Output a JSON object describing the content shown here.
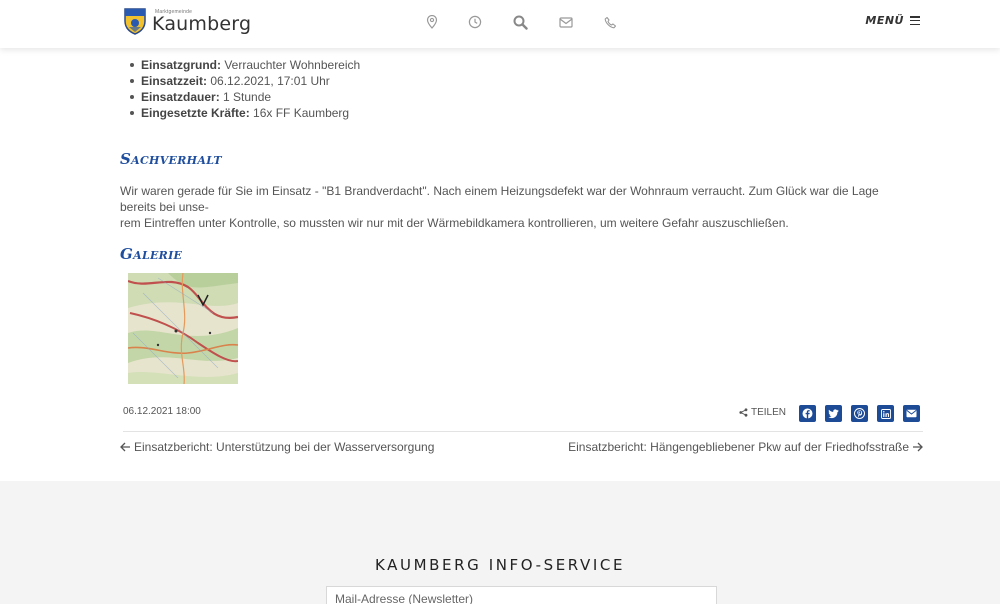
{
  "header": {
    "logo_sub": "Marktgemeinde",
    "logo_main": "Kaumberg",
    "icons": [
      "location-pin-icon",
      "clock-icon",
      "search-icon",
      "envelope-icon",
      "phone-icon"
    ],
    "menu_label": "MENÜ"
  },
  "facts": [
    {
      "label": "Einsatzgrund:",
      "value": "Verrauchter Wohnbereich"
    },
    {
      "label": "Einsatzzeit:",
      "value": "06.12.2021, 17:01 Uhr"
    },
    {
      "label": "Einsatzdauer:",
      "value": "1 Stunde"
    },
    {
      "label": "Eingesetzte Kräfte:",
      "value": "16x FF Kaumberg"
    }
  ],
  "sachverhalt": {
    "heading": "Sachverhalt",
    "line1": "Wir waren gerade für Sie im Einsatz - \"B1 Brandverdacht\". Nach einem Heizungsdefekt war der Wohnraum verraucht. Zum Glück war die Lage bereits bei unse-",
    "line2": "rem Eintreffen unter Kontrolle, so mussten wir nur mit der Wärmebildkamera kontrollieren, um weitere Gefahr auszuschließen."
  },
  "galerie": {
    "heading": "Galerie"
  },
  "post": {
    "date": "06.12.2021 18:00",
    "share_label": "TEILEN"
  },
  "share_buttons": [
    "facebook-icon",
    "twitter-icon",
    "pinterest-icon",
    "linkedin-icon",
    "mail-icon"
  ],
  "nav": {
    "prev": "Einsatzbericht: Unterstützung bei der Wasserversorgung",
    "next": "Einsatzbericht: Hängengebliebener Pkw auf der Friedhofsstraße"
  },
  "footer": {
    "title": "KAUMBERG INFO-SERVICE",
    "newsletter_placeholder": "Mail-Adresse (Newsletter)"
  },
  "colors": {
    "accent": "#1f4e9e",
    "share_bg": "#1d4b96",
    "footer_bg": "#f4f4f4"
  }
}
